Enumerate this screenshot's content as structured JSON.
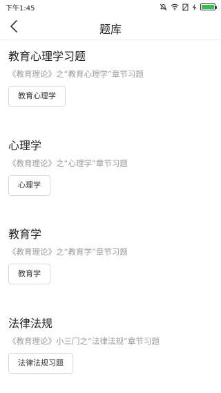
{
  "status_bar": {
    "time": "下午1:45",
    "icons": [
      "mute-icon",
      "wifi-icon",
      "sim-off-icon",
      "charging-icon",
      "battery-icon"
    ]
  },
  "nav": {
    "back_icon": "chevron-left-icon",
    "title": "题库"
  },
  "sections": [
    {
      "title": "教育心理学习题",
      "subtitle": "《教育理论》之“教育心理学”章节习题",
      "button": "教育心理学"
    },
    {
      "title": "心理学",
      "subtitle": "《教育理论》之“心理学”章节习题",
      "button": "心理学"
    },
    {
      "title": "教育学",
      "subtitle": "《教育理论》之“教育学”章节习题",
      "button": "教育学"
    },
    {
      "title": "法律法规",
      "subtitle": "《教育理论》小三门之“法律法规”章节习题",
      "button": "法律法规习题"
    }
  ]
}
